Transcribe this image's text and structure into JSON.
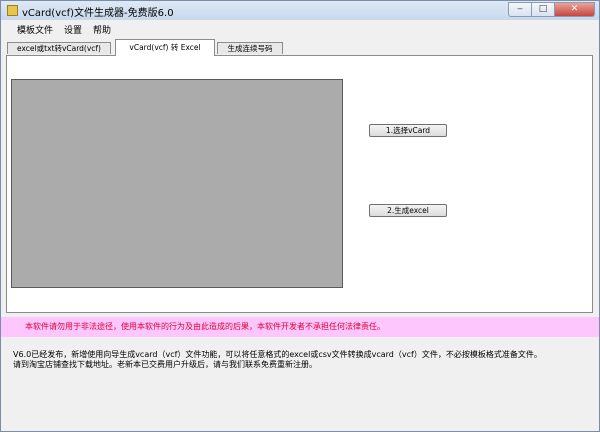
{
  "window": {
    "title": "vCard(vcf)文件生成器-免费版6.0",
    "minimize_glyph": "‒",
    "maximize_glyph": "□",
    "close_glyph": "✕"
  },
  "menu": {
    "items": [
      "模板文件",
      "设置",
      "帮助"
    ]
  },
  "tabs": [
    {
      "label": "excel或txt转vCard(vcf)"
    },
    {
      "label": "vCard(vcf) 转 Excel"
    },
    {
      "label": "生成连续号码"
    }
  ],
  "active_tab_index": 1,
  "buttons": {
    "select_vcard": "1.选择vCard",
    "generate_excel": "2.生成excel"
  },
  "warning": "本软件请勿用于非法途径，使用本软件的行为及由此造成的后果，本软件开发者不承担任何法律责任。",
  "info": {
    "line1": "V6.0已经发布，新增使用向导生成vcard（vcf）文件功能，可以将任意格式的excel或csv文件转换成vcard（vcf）文件，不必按模板格式准备文件。",
    "line2": "请到淘宝店铺查找下载地址。老新本已交费用户升级后，请与我们联系免费重新注册。"
  },
  "colors": {
    "warning_bg": "#fdc6fd",
    "warning_text": "#e0003a",
    "preview_bg": "#ababab"
  }
}
